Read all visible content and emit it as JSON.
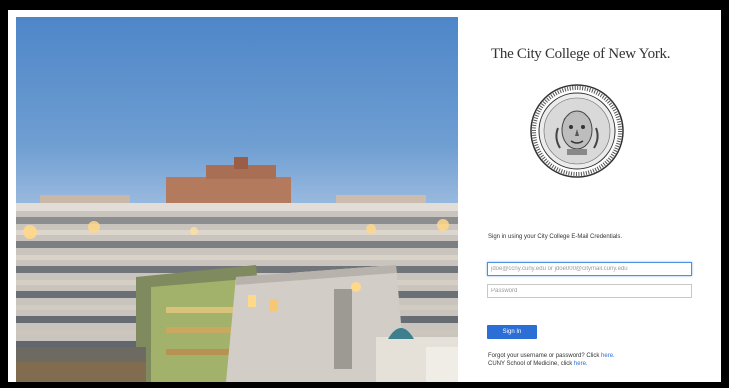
{
  "college": {
    "name": "The City College of New York."
  },
  "login": {
    "instructions": "Sign in using your City College E-Mail Credentials.",
    "username_placeholder": "jdoe@ccny.cuny.edu or jdoe000@citymail.cuny.edu",
    "password_placeholder": "Password",
    "signin_label": "Sign In"
  },
  "help": {
    "forgot_text": "Forgot your username or password? Click ",
    "forgot_link": "here.",
    "medicine_text": "CUNY School of Medicine, click ",
    "medicine_link": "here."
  },
  "colors": {
    "button": "#2b6ed6",
    "link": "#2b6ed6",
    "focus_border": "#4f8fe0"
  }
}
